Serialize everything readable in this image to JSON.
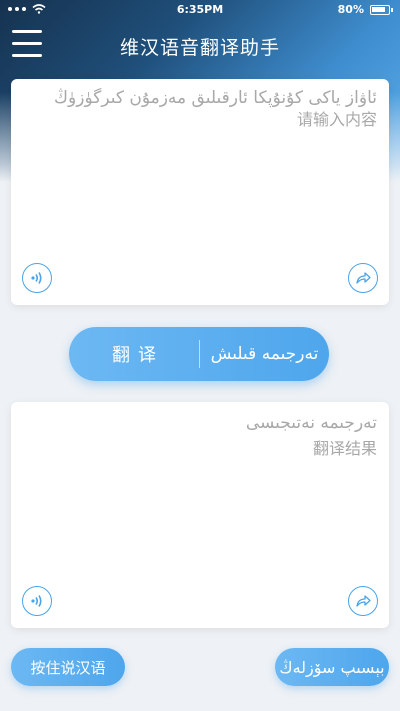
{
  "status_bar": {
    "time": "6:35PM",
    "battery": "80%",
    "icons": [
      "signal-dots-icon",
      "wifi-icon",
      "battery-icon"
    ]
  },
  "header": {
    "title": "维汉语音翻译助手",
    "menu_icon": "hamburger-menu-icon"
  },
  "input_card": {
    "placeholder_ug": "ئاۋاز ياكى كۇنۇپكا ئارقىلىق مەزمۇن كىرگۈزۈڭ",
    "placeholder_zh": "请输入内容",
    "left_icon": "speaker-icon",
    "right_icon": "share-icon"
  },
  "translate_button": {
    "label_zh": "翻译",
    "label_ug": "تەرجىمە قىلىش"
  },
  "output_card": {
    "placeholder_ug": "تەرجىمە نەتىجىسى",
    "placeholder_zh": "翻译结果",
    "left_icon": "speaker-icon",
    "right_icon": "share-icon"
  },
  "bottom_buttons": {
    "left_label": "按住说汉语",
    "right_label": "بېسىپ سۆزلەڭ"
  },
  "colors": {
    "accent": "#4ea6ec",
    "header_dark": "#16324f",
    "placeholder": "#a8a8a8",
    "background": "#eef1f5"
  }
}
